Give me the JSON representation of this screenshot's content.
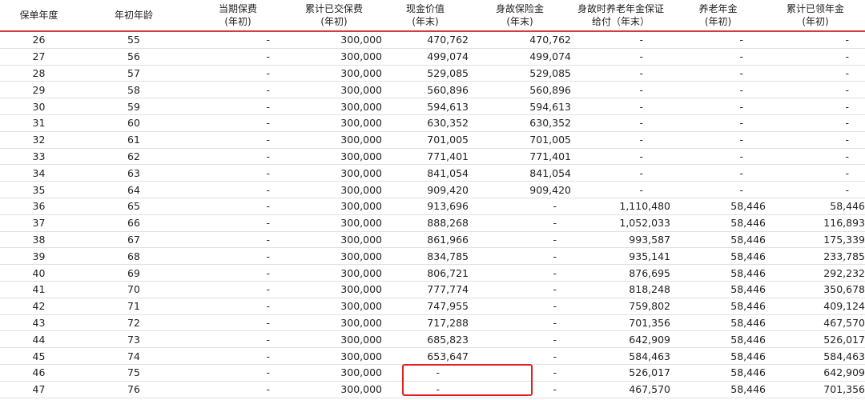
{
  "headers": [
    {
      "line1": "保单年度",
      "line2": ""
    },
    {
      "line1": "年初年龄",
      "line2": ""
    },
    {
      "line1": "当期保费",
      "line2": "(年初)"
    },
    {
      "line1": "累计已交保费",
      "line2": "(年初)"
    },
    {
      "line1": "现金价值",
      "line2": "(年末)"
    },
    {
      "line1": "身故保险金",
      "line2": "(年末)"
    },
    {
      "line1": "身故时养老年金保证",
      "line2": "给付（年末）"
    },
    {
      "line1": "养老年金",
      "line2": "(年初)"
    },
    {
      "line1": "累计已领年金",
      "line2": "(年初)"
    }
  ],
  "rows": [
    [
      "26",
      "55",
      "-",
      "300,000",
      "470,762",
      "470,762",
      "-",
      "-",
      "-"
    ],
    [
      "27",
      "56",
      "-",
      "300,000",
      "499,074",
      "499,074",
      "-",
      "-",
      "-"
    ],
    [
      "28",
      "57",
      "-",
      "300,000",
      "529,085",
      "529,085",
      "-",
      "-",
      "-"
    ],
    [
      "29",
      "58",
      "-",
      "300,000",
      "560,896",
      "560,896",
      "-",
      "-",
      "-"
    ],
    [
      "30",
      "59",
      "-",
      "300,000",
      "594,613",
      "594,613",
      "-",
      "-",
      "-"
    ],
    [
      "31",
      "60",
      "-",
      "300,000",
      "630,352",
      "630,352",
      "-",
      "-",
      "-"
    ],
    [
      "32",
      "61",
      "-",
      "300,000",
      "701,005",
      "701,005",
      "-",
      "-",
      "-"
    ],
    [
      "33",
      "62",
      "-",
      "300,000",
      "771,401",
      "771,401",
      "-",
      "-",
      "-"
    ],
    [
      "34",
      "63",
      "-",
      "300,000",
      "841,054",
      "841,054",
      "-",
      "-",
      "-"
    ],
    [
      "35",
      "64",
      "-",
      "300,000",
      "909,420",
      "909,420",
      "-",
      "-",
      "-"
    ],
    [
      "36",
      "65",
      "-",
      "300,000",
      "913,696",
      "-",
      "1,110,480",
      "58,446",
      "58,446"
    ],
    [
      "37",
      "66",
      "-",
      "300,000",
      "888,268",
      "-",
      "1,052,033",
      "58,446",
      "116,893"
    ],
    [
      "38",
      "67",
      "-",
      "300,000",
      "861,966",
      "-",
      "993,587",
      "58,446",
      "175,339"
    ],
    [
      "39",
      "68",
      "-",
      "300,000",
      "834,785",
      "-",
      "935,141",
      "58,446",
      "233,785"
    ],
    [
      "40",
      "69",
      "-",
      "300,000",
      "806,721",
      "-",
      "876,695",
      "58,446",
      "292,232"
    ],
    [
      "41",
      "70",
      "-",
      "300,000",
      "777,774",
      "-",
      "818,248",
      "58,446",
      "350,678"
    ],
    [
      "42",
      "71",
      "-",
      "300,000",
      "747,955",
      "-",
      "759,802",
      "58,446",
      "409,124"
    ],
    [
      "43",
      "72",
      "-",
      "300,000",
      "717,288",
      "-",
      "701,356",
      "58,446",
      "467,570"
    ],
    [
      "44",
      "73",
      "-",
      "300,000",
      "685,823",
      "-",
      "642,909",
      "58,446",
      "526,017"
    ],
    [
      "45",
      "74",
      "-",
      "300,000",
      "653,647",
      "-",
      "584,463",
      "58,446",
      "584,463"
    ],
    [
      "46",
      "75",
      "-",
      "300,000",
      "-",
      "-",
      "526,017",
      "58,446",
      "642,909"
    ],
    [
      "47",
      "76",
      "-",
      "300,000",
      "-",
      "-",
      "467,570",
      "58,446",
      "701,356"
    ]
  ],
  "colors": {
    "header_rule": "#d43b3b",
    "highlight": "#e02020"
  }
}
